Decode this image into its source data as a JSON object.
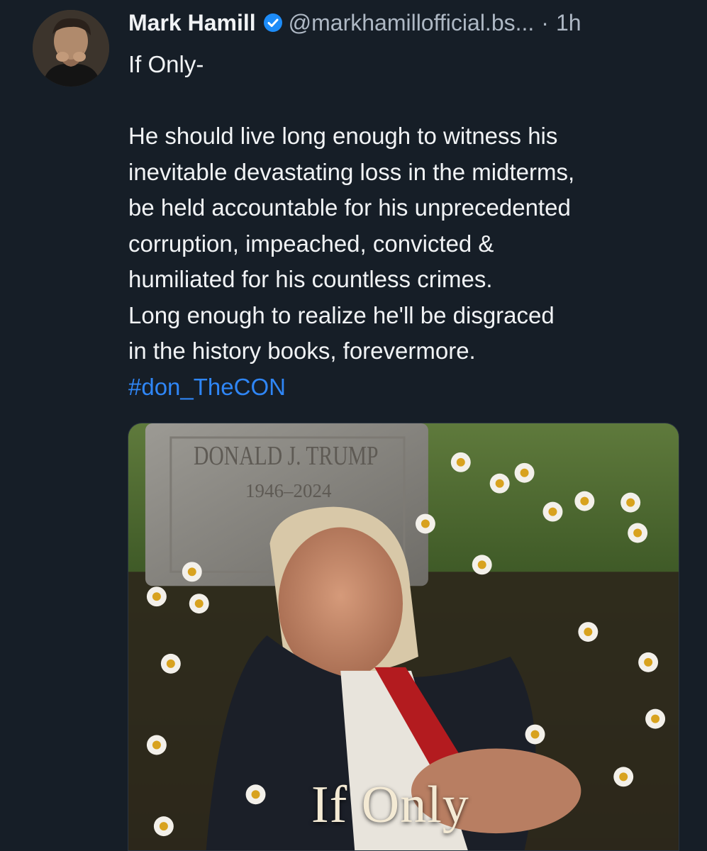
{
  "post": {
    "author": {
      "display_name": "Mark Hamill",
      "handle": "@markhamillofficial.bs...",
      "separator": "·",
      "time": "1h"
    },
    "text": {
      "line_title": "If Only-",
      "lines": [
        "He should live long enough to witness his",
        "inevitable devastating loss in the midterms,",
        "be held accountable for his unprecedented",
        "corruption, impeached, convicted &",
        "humiliated for his countless crimes.",
        "Long enough to realize he'll be disgraced",
        "in the history books, forevermore."
      ],
      "hashtag": "#don_TheCON"
    },
    "media": {
      "headstone_name": "DONALD J. TRUMP",
      "headstone_years": "1946–2024",
      "caption": "If Only"
    }
  },
  "colors": {
    "background": "#161e27",
    "text": "#f1f3f5",
    "muted": "#aeb8c4",
    "link": "#2f86f6",
    "verified": "#1d8cf8"
  },
  "icons": {
    "verified": "verified-badge-icon"
  }
}
